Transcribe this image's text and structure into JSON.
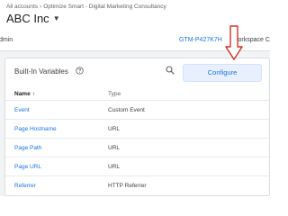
{
  "header": {
    "breadcrumb": [
      "All accounts",
      "Optimize Smart - Digital Marketing Consultancy"
    ],
    "breadcrumb_sep": "›",
    "account_name": "ABC Inc"
  },
  "subbar": {
    "left_text": "dmin",
    "container_id": "GTM-P427K7H",
    "workspace_label": "Workspace C"
  },
  "builtin_variables": {
    "title": "Built-In Variables",
    "configure_label": "Configure",
    "columns": {
      "name": "Name",
      "type": "Type"
    },
    "rows": [
      {
        "name": "Event",
        "type": "Custom Event"
      },
      {
        "name": "Page Hostname",
        "type": "URL"
      },
      {
        "name": "Page Path",
        "type": "URL"
      },
      {
        "name": "Page URL",
        "type": "URL"
      },
      {
        "name": "Referrer",
        "type": "HTTP Referrer"
      }
    ]
  },
  "colors": {
    "accent": "#1a73e8",
    "annotation_arrow": "#d93025"
  }
}
